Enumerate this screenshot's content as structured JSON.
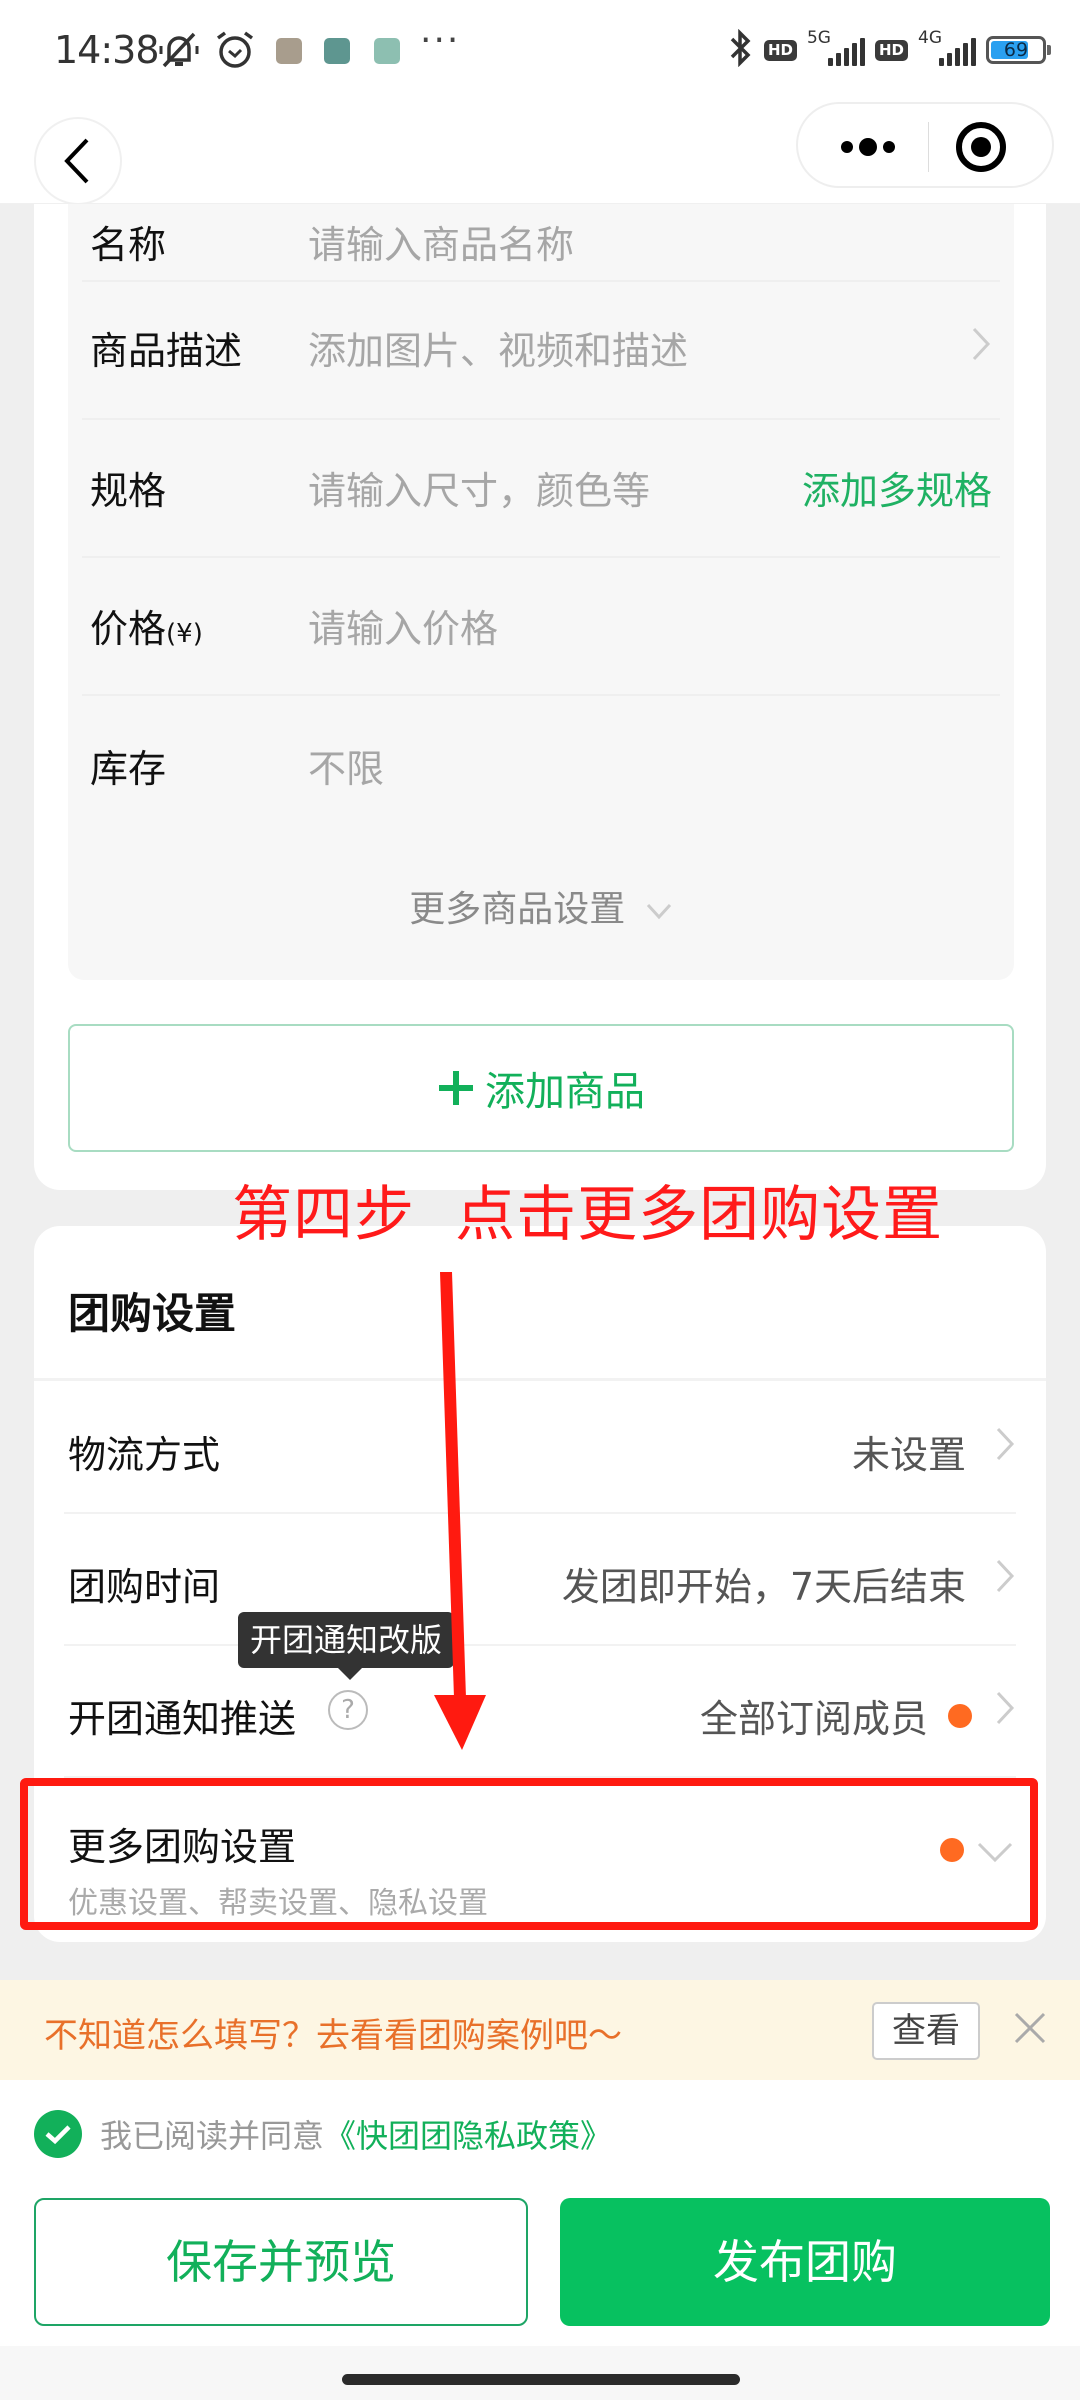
{
  "status_bar": {
    "time": "14:38",
    "icons": [
      "mute-bell-icon",
      "alarm-icon",
      "qq-app-icon",
      "card-app-icon",
      "alipay-app-icon",
      "overflow-dots-icon"
    ],
    "right_icons": [
      "bluetooth-icon",
      "hd-icon",
      "5g-signal-icon",
      "hd-icon",
      "4g-signal-icon",
      "battery-icon"
    ],
    "hd_label": "HD",
    "sim1_network": "5G",
    "sim2_network": "4G",
    "battery_level": "69",
    "colors": {
      "battery_fill": "#2aa0f0"
    }
  },
  "navbar": {
    "back_icon": "chevron-left-icon",
    "menu_icon": "more-dots-icon",
    "close_icon": "target-circle-icon"
  },
  "product_form": {
    "fields": [
      {
        "label": "名称",
        "placeholder": "请输入商品名称"
      },
      {
        "label": "商品描述",
        "placeholder": "添加图片、视频和描述",
        "trailing": "chevron-right-icon"
      },
      {
        "label": "规格",
        "placeholder": "请输入尺寸，颜色等",
        "action": "添加多规格"
      },
      {
        "label": "价格",
        "label_suffix": "(¥)",
        "placeholder": "请输入价格"
      },
      {
        "label": "库存",
        "value": "不限"
      }
    ],
    "more_settings": "更多商品设置",
    "add_product": "添加商品"
  },
  "annotation": {
    "text": "第四步  点击更多团购设置",
    "color": "#ff1a1a"
  },
  "group_settings": {
    "title": "团购设置",
    "rows": [
      {
        "label": "物流方式",
        "value": "未设置"
      },
      {
        "label": "团购时间",
        "value": "发团即开始，7天后结束"
      },
      {
        "label": "开团通知推送",
        "value": "全部订阅成员",
        "has_help": true,
        "has_dot": true
      }
    ],
    "tooltip": "开团通知改版",
    "help_glyph": "?",
    "more": {
      "title": "更多团购设置",
      "subtitle": "优惠设置、帮卖设置、隐私设置"
    }
  },
  "tip_bar": {
    "text": "不知道怎么填写？去看看团购案例吧～",
    "view_button": "查看",
    "close_icon": "close-icon"
  },
  "footer": {
    "agree_text": "我已阅读并同意",
    "policy_link": "《快团团隐私政策》",
    "agreed": true,
    "save_button": "保存并预览",
    "publish_button": "发布团购"
  },
  "colors": {
    "brand_green": "#07c160",
    "link_green": "#12b05a",
    "notice_orange": "#ff6a21",
    "tip_bg": "#fdf6e3",
    "tip_text": "#e8702a"
  }
}
